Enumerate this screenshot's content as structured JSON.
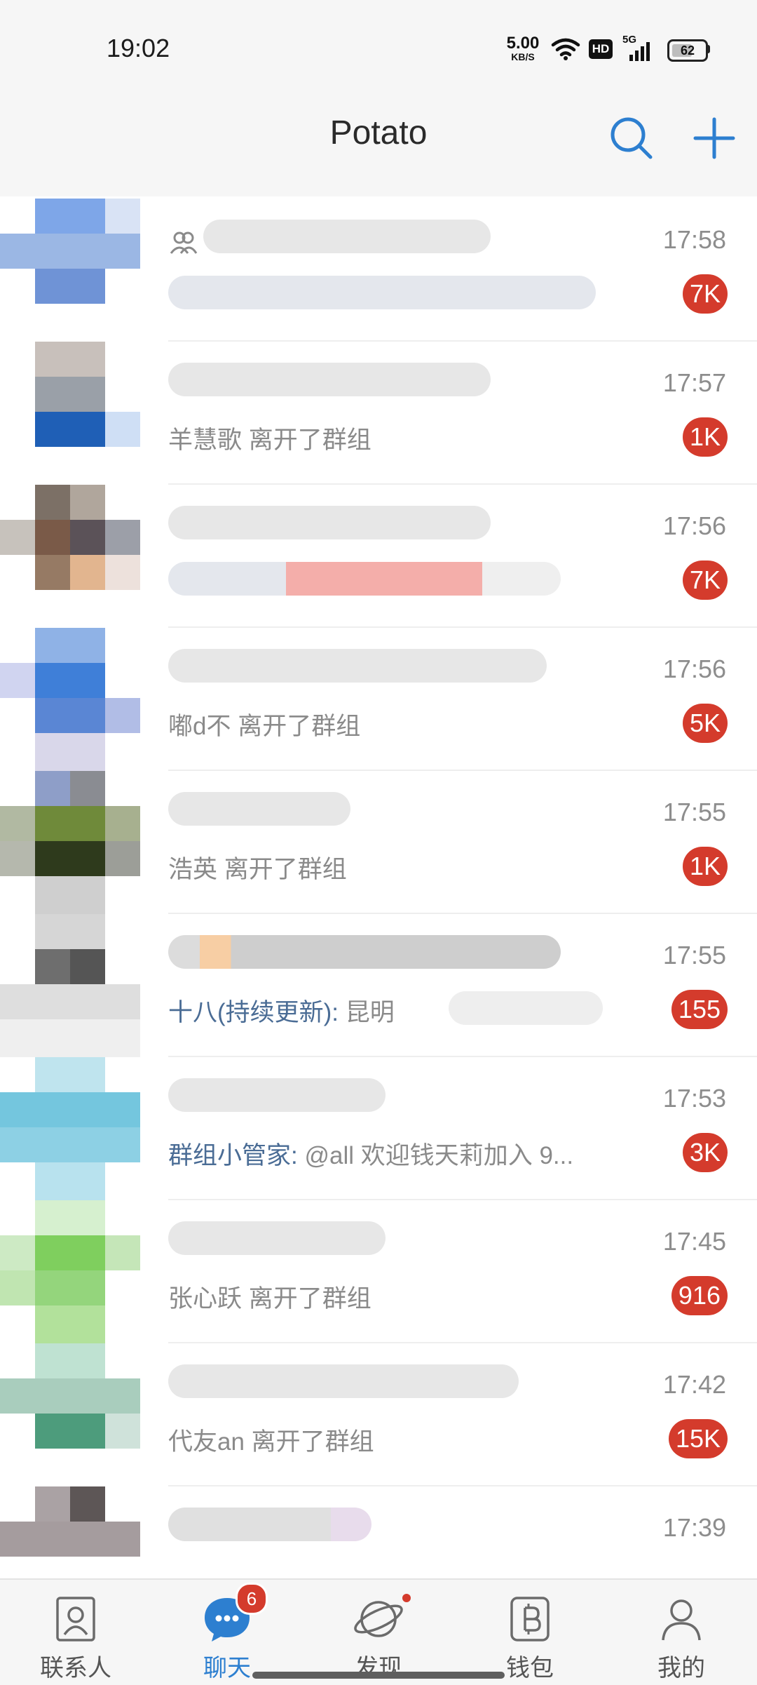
{
  "status_bar": {
    "time": "19:02",
    "net_speed_value": "5.00",
    "net_speed_unit": "KB/S",
    "hd_label": "HD",
    "network_label": "5G",
    "battery": "62"
  },
  "header": {
    "title": "Potato",
    "search_icon": "search-icon",
    "add_icon": "plus-icon"
  },
  "chats": [
    {
      "time": "17:58",
      "badge": "7K",
      "sender": "",
      "message": ""
    },
    {
      "time": "17:57",
      "badge": "1K",
      "sender": "",
      "message": "羊慧歌 离开了群组"
    },
    {
      "time": "17:56",
      "badge": "7K",
      "sender": "",
      "message": ""
    },
    {
      "time": "17:56",
      "badge": "5K",
      "sender": "",
      "message": "嘟d不 离开了群组"
    },
    {
      "time": "17:55",
      "badge": "1K",
      "sender": "",
      "message": "浩英 离开了群组"
    },
    {
      "time": "17:55",
      "badge": "155",
      "sender": "十八(持续更新):",
      "message": "昆明"
    },
    {
      "time": "17:53",
      "badge": "3K",
      "sender": "群组小管家:",
      "message": "@all 欢迎钱天莉加入  9..."
    },
    {
      "time": "17:45",
      "badge": "916",
      "sender": "",
      "message": "张心跃 离开了群组"
    },
    {
      "time": "17:42",
      "badge": "15K",
      "sender": "",
      "message": "代友an 离开了群组"
    },
    {
      "time": "17:39",
      "badge": "",
      "sender": "",
      "message": ""
    }
  ],
  "tabs": [
    {
      "label": "联系人",
      "icon": "contacts-icon"
    },
    {
      "label": "聊天",
      "icon": "chat-icon",
      "badge": "6"
    },
    {
      "label": "发现",
      "icon": "discover-icon"
    },
    {
      "label": "钱包",
      "icon": "wallet-icon"
    },
    {
      "label": "我的",
      "icon": "profile-icon"
    }
  ],
  "colors": {
    "accent": "#2d7fd0",
    "badge": "#d43b2c",
    "sender_text": "#4a6c95"
  }
}
